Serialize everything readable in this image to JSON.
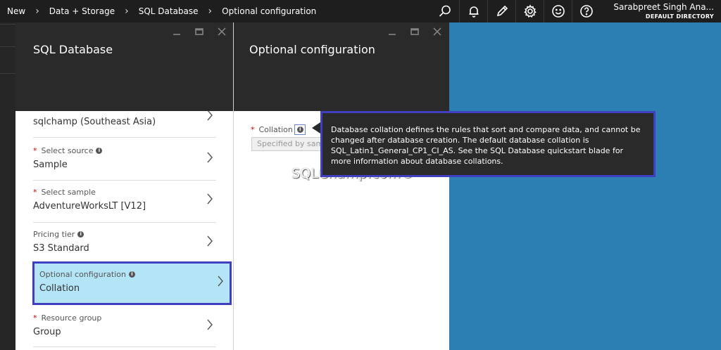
{
  "breadcrumbs": [
    "New",
    "Data + Storage",
    "SQL Database",
    "Optional configuration"
  ],
  "user": {
    "name": "Sarabpreet Singh Ana...",
    "directory": "DEFAULT DIRECTORY"
  },
  "top_icons": [
    "search-icon",
    "bell-icon",
    "pencil-icon",
    "gear-icon",
    "smiley-icon",
    "help-icon"
  ],
  "blade1": {
    "title": "SQL Database",
    "items": [
      {
        "label": "",
        "value": "sqlchamp (Southeast Asia)",
        "required": false
      },
      {
        "label": "Select source",
        "value": "Sample",
        "required": true,
        "info": true
      },
      {
        "label": "Select sample",
        "value": "AdventureWorksLT [V12]",
        "required": true,
        "info": false
      },
      {
        "label": "Pricing tier",
        "value": "S3 Standard",
        "required": false,
        "info": true
      },
      {
        "label": "Optional configuration",
        "value": "Collation",
        "required": false,
        "info": true,
        "selected": true
      },
      {
        "label": "Resource group",
        "value": "Group",
        "required": true,
        "info": false
      }
    ]
  },
  "blade2": {
    "title": "Optional configuration",
    "collation_label": "Collation",
    "collation_placeholder": "Specified by samp"
  },
  "tooltip": "Database collation defines the rules that sort and compare data, and cannot be changed after database creation. The default database collation is SQL_Latin1_General_CP1_CI_AS. See the SQL Database quickstart blade for more information about database collations.",
  "watermark": "SQLChamp.com©",
  "colors": {
    "topbar": "#1e1e1e",
    "blade_header": "#2a2a2a",
    "background": "#2c7fb3",
    "selected_fill": "#b3e5f7",
    "highlight_border": "#3f3fbf"
  }
}
